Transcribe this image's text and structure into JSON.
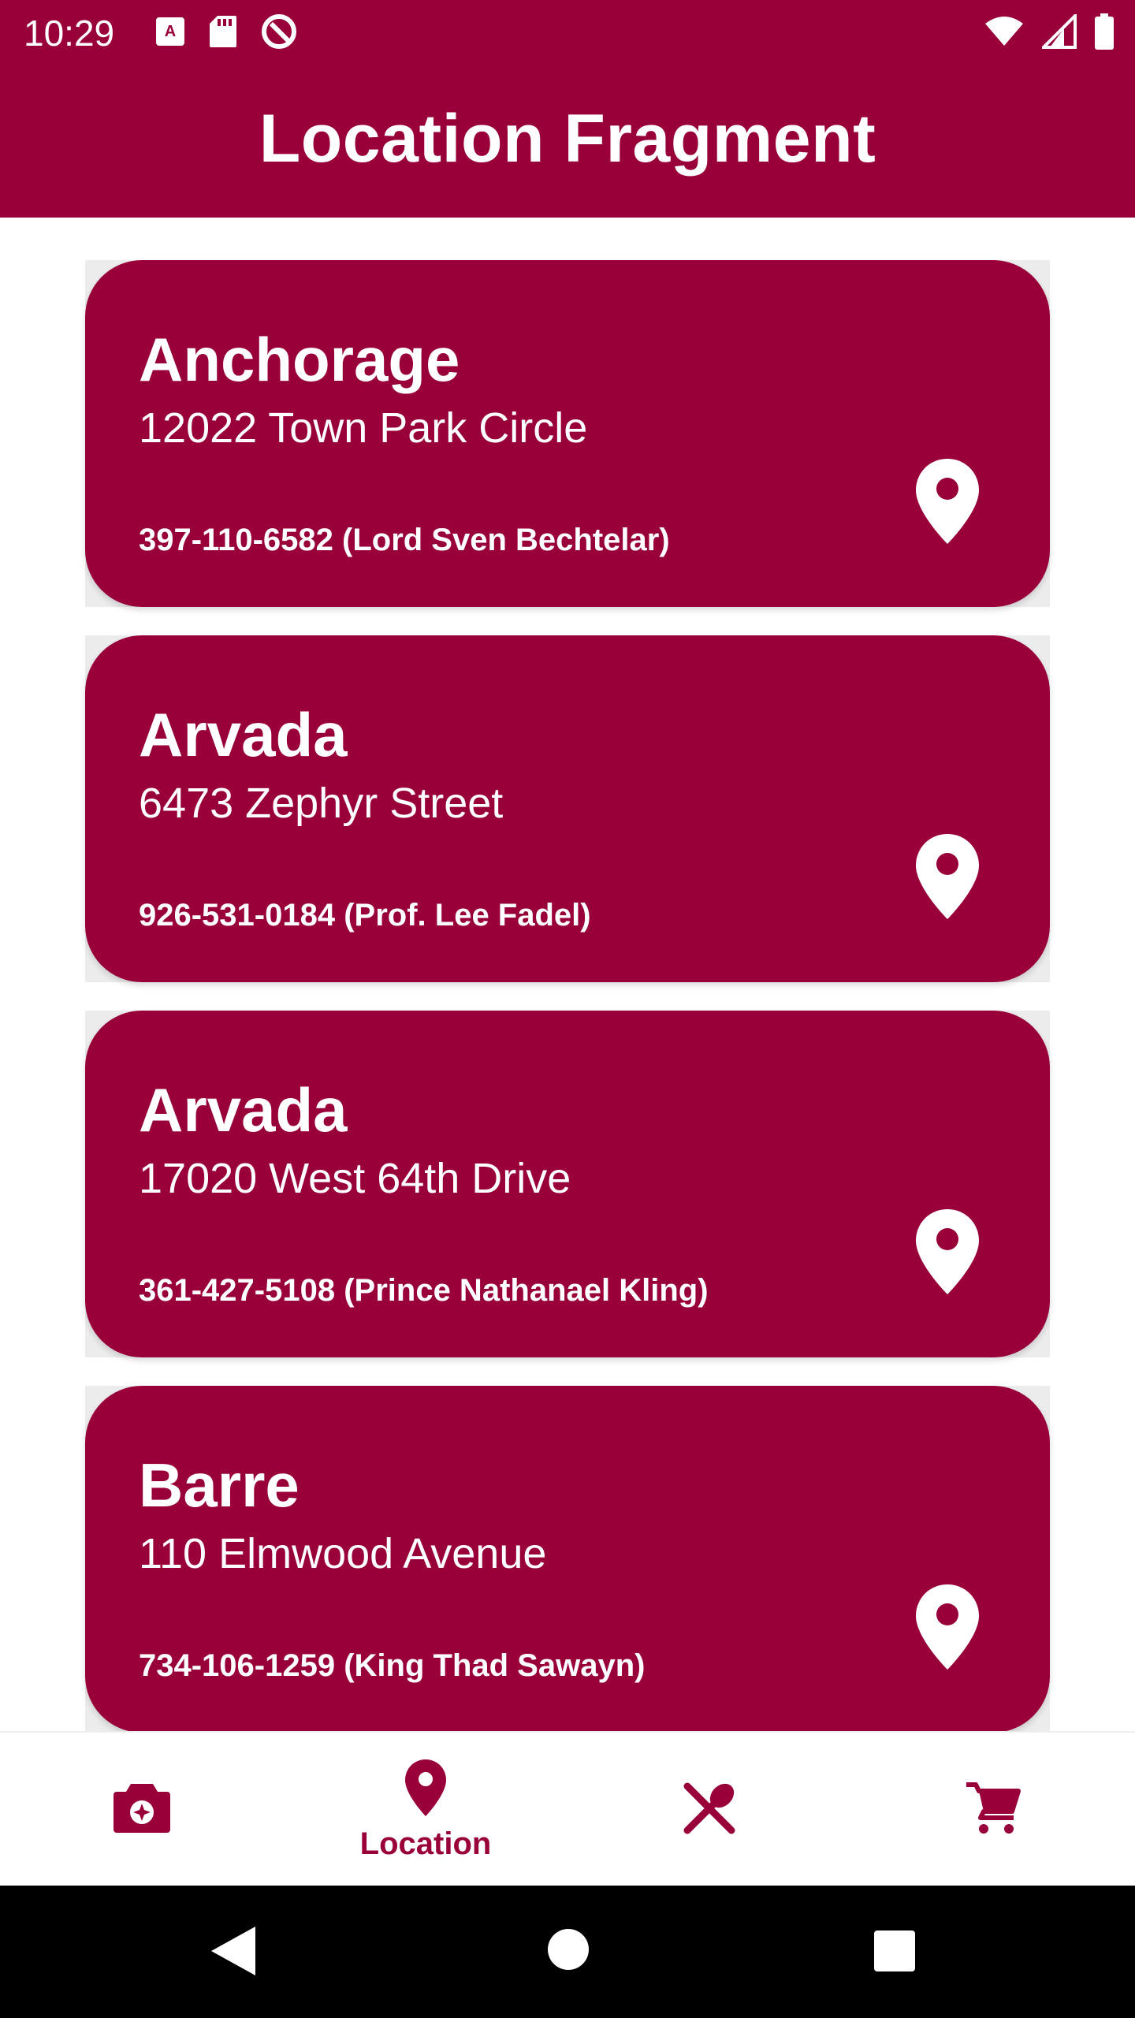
{
  "status_bar": {
    "time": "10:29",
    "left_icons": [
      "keyboard-icon",
      "sd-card-icon",
      "do-not-disturb-icon"
    ],
    "right_icons": [
      "wifi-icon",
      "cell-signal-icon",
      "battery-icon"
    ]
  },
  "app_bar": {
    "title": "Location Fragment"
  },
  "locations": [
    {
      "city": "Anchorage",
      "address": "12022 Town Park Circle",
      "phone": "397-110-6582 (Lord Sven Bechtelar)"
    },
    {
      "city": "Arvada",
      "address": "6473 Zephyr Street",
      "phone": "926-531-0184 (Prof. Lee Fadel)"
    },
    {
      "city": "Arvada",
      "address": "17020 West 64th Drive",
      "phone": "361-427-5108 (Prince Nathanael Kling)"
    },
    {
      "city": "Barre",
      "address": "110 Elmwood Avenue",
      "phone": "734-106-1259 (King Thad Sawayn)"
    }
  ],
  "bottom_nav": {
    "items": [
      {
        "icon": "camera-icon",
        "label": "",
        "selected": false
      },
      {
        "icon": "location-pin-icon",
        "label": "Location",
        "selected": true
      },
      {
        "icon": "utensils-icon",
        "label": "",
        "selected": false
      },
      {
        "icon": "cart-icon",
        "label": "",
        "selected": false
      }
    ]
  },
  "colors": {
    "primary": "#990039",
    "on_primary": "#ffffff",
    "system_nav": "#000000"
  }
}
